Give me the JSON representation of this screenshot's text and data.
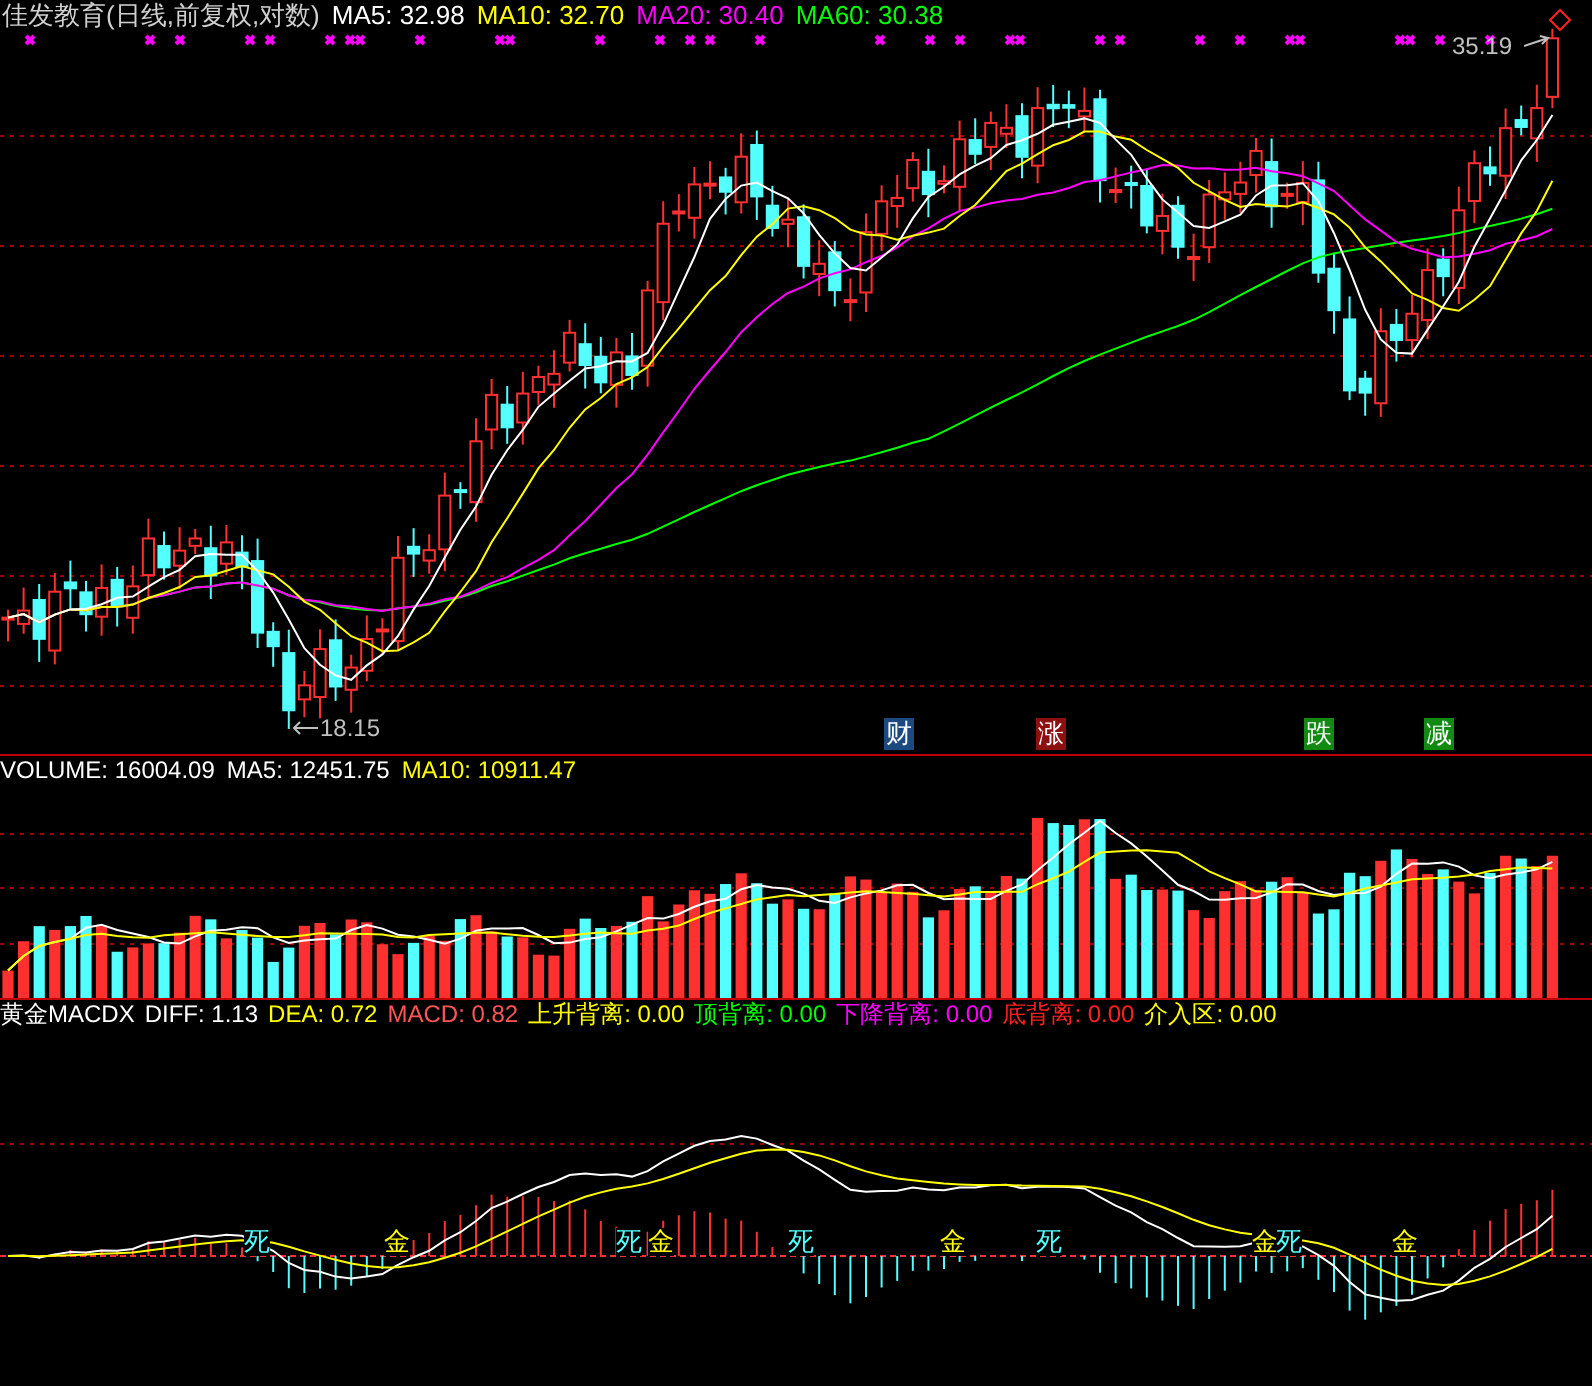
{
  "price_chart": {
    "title": "佳发教育(日线,前复权,对数)",
    "indicators": [
      {
        "label": "MA5: 32.98",
        "color": "#ffffff"
      },
      {
        "label": "MA10: 32.70",
        "color": "#ffff00"
      },
      {
        "label": "MA20: 30.40",
        "color": "#ff00ff"
      },
      {
        "label": "MA60: 30.38",
        "color": "#00ff00"
      }
    ],
    "high_label": "35.19",
    "low_label": "18.15",
    "tags": [
      {
        "text": "财",
        "color": "#1c4a80"
      },
      {
        "text": "涨",
        "color": "#8c1010"
      },
      {
        "text": "跌",
        "color": "#108a10"
      },
      {
        "text": "减",
        "color": "#108a10"
      }
    ]
  },
  "volume_chart": {
    "indicators": [
      {
        "label": "VOLUME: 16004.09",
        "color": "#ffffff"
      },
      {
        "label": "MA5: 12451.75",
        "color": "#ffffff"
      },
      {
        "label": "MA10: 10911.47",
        "color": "#ffff00"
      }
    ]
  },
  "macd_chart": {
    "indicators": [
      {
        "label": "黄金MACDX",
        "color": "#ffffff"
      },
      {
        "label": "DIFF: 1.13",
        "color": "#ffffff"
      },
      {
        "label": "DEA: 0.72",
        "color": "#ffff00"
      },
      {
        "label": "MACD: 0.82",
        "color": "#ff5555"
      },
      {
        "label": "上升背离: 0.00",
        "color": "#ffff00"
      },
      {
        "label": "顶背离: 0.00",
        "color": "#00ff00"
      },
      {
        "label": "下降背离: 0.00",
        "color": "#ff00ff"
      },
      {
        "label": "底背离: 0.00",
        "color": "#ff2020"
      },
      {
        "label": "介入区: 0.00",
        "color": "#ffff00"
      }
    ],
    "signals": [
      {
        "text": "死",
        "color": "#55ffff"
      },
      {
        "text": "金",
        "color": "#ffff00"
      },
      {
        "text": "死",
        "color": "#55ffff"
      },
      {
        "text": "金",
        "color": "#ffff00"
      },
      {
        "text": "死",
        "color": "#55ffff"
      },
      {
        "text": "金",
        "color": "#ffff00"
      },
      {
        "text": "死",
        "color": "#55ffff"
      },
      {
        "text": "金",
        "color": "#ffff00"
      },
      {
        "text": "死",
        "color": "#55ffff"
      },
      {
        "text": "金",
        "color": "#ffff00"
      }
    ]
  }
}
